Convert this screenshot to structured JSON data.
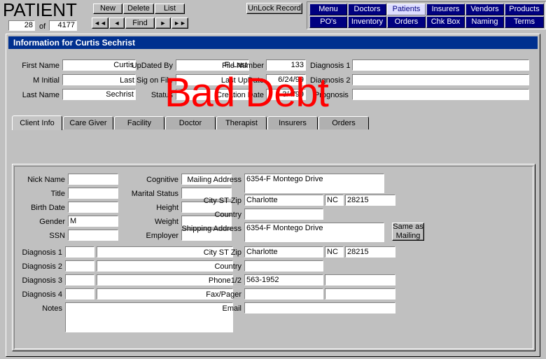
{
  "header": {
    "app_title": "PATIENT",
    "record_index": "28",
    "of_label": "of",
    "record_total": "4177",
    "record_buttons": [
      {
        "name": "new",
        "label": "New"
      },
      {
        "name": "delete",
        "label": "Delete"
      },
      {
        "name": "list",
        "label": "List"
      }
    ],
    "nav_buttons": [
      {
        "name": "first",
        "label": "◄◄"
      },
      {
        "name": "previous",
        "label": "◄"
      },
      {
        "name": "find",
        "label": "Find"
      },
      {
        "name": "next",
        "label": "►"
      },
      {
        "name": "last",
        "label": "►►"
      }
    ],
    "unlock_label": "UnLock Record",
    "module_nav_row1": [
      {
        "name": "menu",
        "label": "Menu",
        "active": false
      },
      {
        "name": "doctors",
        "label": "Doctors",
        "active": false
      },
      {
        "name": "patients",
        "label": "Patients",
        "active": true
      },
      {
        "name": "insurers",
        "label": "Insurers",
        "active": false
      },
      {
        "name": "vendors",
        "label": "Vendors",
        "active": false
      },
      {
        "name": "products",
        "label": "Products",
        "active": false
      }
    ],
    "module_nav_row2": [
      {
        "name": "pos",
        "label": "PO's",
        "active": false
      },
      {
        "name": "inventory",
        "label": "Inventory",
        "active": false
      },
      {
        "name": "orders",
        "label": "Orders",
        "active": false
      },
      {
        "name": "chk-box",
        "label": "Chk Box",
        "active": false
      },
      {
        "name": "naming",
        "label": "Naming",
        "active": false
      },
      {
        "name": "terms",
        "label": "Terms",
        "active": false
      }
    ]
  },
  "window": {
    "title": "Information for Curtis Sechrist",
    "stamp": "Bad Debt",
    "stamp_color": "#ff0000"
  },
  "patient_header": {
    "first_name_label": "First Name",
    "first_name_value": "Curtis",
    "m_initial_label": "M Initial",
    "m_initial_value": "",
    "last_name_label": "Last Name",
    "last_name_value": "Sechrist",
    "updated_by_label": "UpDated By",
    "updated_by_value": "F. Last",
    "last_sig_label": "Last Sig on File",
    "last_sig_value": "",
    "status_label": "Status",
    "status_value": "",
    "file_number_label": "File Number",
    "file_number_value": "133",
    "last_update_label": "Last UpDate",
    "last_update_value": "6/24/99",
    "creation_date_label": "Creation Date",
    "creation_date_value": "3/4/99",
    "diagnosis1_label": "Diagnosis 1",
    "diagnosis1_value": "",
    "diagnosis2_label": "Diagnosis 2",
    "diagnosis2_value": "",
    "prognosis_label": "Prognosis",
    "prognosis_value": ""
  },
  "tabs": [
    {
      "name": "client-info",
      "label": "Client Info",
      "selected": true
    },
    {
      "name": "care-giver",
      "label": "Care Giver",
      "selected": false
    },
    {
      "name": "facility",
      "label": "Facility",
      "selected": false
    },
    {
      "name": "doctor",
      "label": "Doctor",
      "selected": false
    },
    {
      "name": "therapist",
      "label": "Therapist",
      "selected": false
    },
    {
      "name": "insurers",
      "label": "Insurers",
      "selected": false
    },
    {
      "name": "orders",
      "label": "Orders",
      "selected": false
    }
  ],
  "client_info": {
    "left_column": [
      {
        "name": "nick-name",
        "label": "Nick Name",
        "value": ""
      },
      {
        "name": "title",
        "label": "Title",
        "value": ""
      },
      {
        "name": "birth-date",
        "label": "Birth Date",
        "value": ""
      },
      {
        "name": "gender",
        "label": "Gender",
        "value": "M"
      },
      {
        "name": "ssn",
        "label": "SSN",
        "value": ""
      }
    ],
    "middle_column": [
      {
        "name": "cognitive",
        "label": "Cognitive",
        "value": ""
      },
      {
        "name": "marital-status",
        "label": "Marital Status",
        "value": ""
      },
      {
        "name": "height",
        "label": "Height",
        "value": ""
      },
      {
        "name": "weight",
        "label": "Weight",
        "value": ""
      },
      {
        "name": "employer",
        "label": "Employer",
        "value": ""
      }
    ],
    "diagnoses": [
      {
        "name": "diagnosis-1",
        "label": "Diagnosis 1",
        "code": "",
        "text": ""
      },
      {
        "name": "diagnosis-2",
        "label": "Diagnosis 2",
        "code": "",
        "text": ""
      },
      {
        "name": "diagnosis-3",
        "label": "Diagnosis 3",
        "code": "",
        "text": ""
      },
      {
        "name": "diagnosis-4",
        "label": "Diagnosis 4",
        "code": "",
        "text": ""
      }
    ],
    "notes_label": "Notes",
    "notes_value": "",
    "mailing_address_label": "Mailing Address",
    "mailing_address_value": "6354-F Montego Drive",
    "mailing_city_label": "City ST Zip",
    "mailing_city_value": "Charlotte",
    "mailing_state_value": "NC",
    "mailing_zip_value": "28215",
    "mailing_country_label": "Country",
    "mailing_country_value": "",
    "shipping_address_label": "Shipping Address",
    "shipping_address_value": "6354-F Montego Drive",
    "shipping_city_label": "City ST Zip",
    "shipping_city_value": "Charlotte",
    "shipping_state_value": "NC",
    "shipping_zip_value": "28215",
    "shipping_country_label": "Country",
    "shipping_country_value": "",
    "same_as_mailing_label_line1": "Same as",
    "same_as_mailing_label_line2": "Mailing",
    "phone_label": "Phone1/2",
    "phone1_value": "563-1952",
    "phone2_value": "",
    "fax_label": "Fax/Pager",
    "fax_value": "",
    "pager_value": "",
    "email_label": "Email",
    "email_value": ""
  }
}
